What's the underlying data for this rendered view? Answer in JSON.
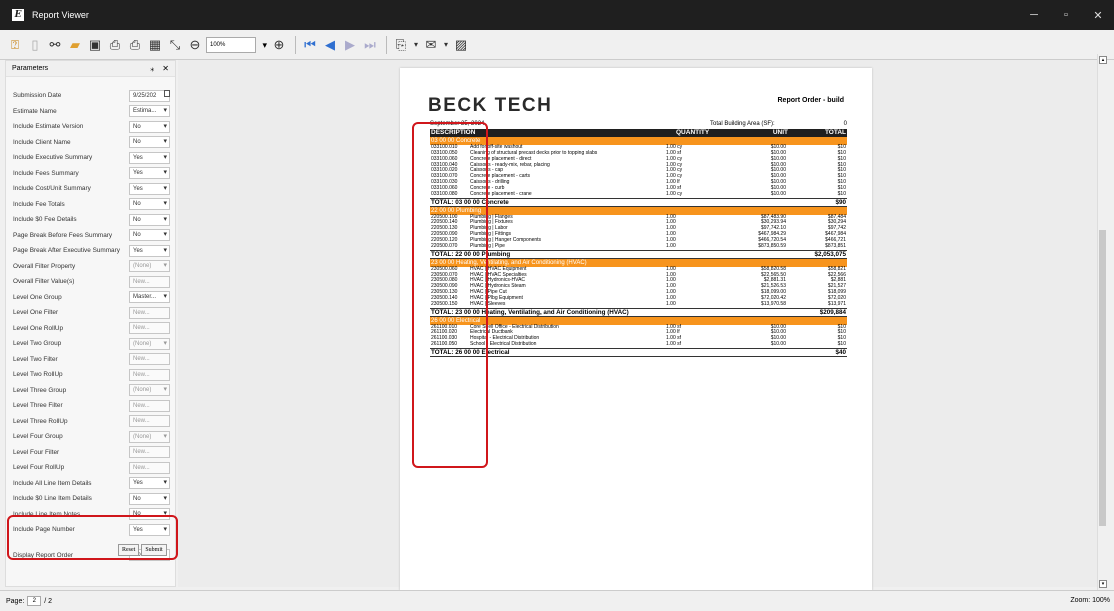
{
  "window": {
    "title": "Report Viewer",
    "app_icon": "E",
    "min": "─",
    "max": "▫",
    "close": "✕"
  },
  "toolbar": {
    "zoom": "100%"
  },
  "parameters": {
    "title": "Parameters",
    "pin": "⁎",
    "close": "✕",
    "rows": [
      {
        "label": "Submission Date",
        "value": "9/25/202",
        "kind": "date"
      },
      {
        "label": "Estimate Name",
        "value": "Estima...",
        "kind": "dd"
      },
      {
        "label": "Include Estimate Version",
        "value": "No",
        "kind": "dd"
      },
      {
        "label": "Include Client Name",
        "value": "No",
        "kind": "dd"
      },
      {
        "label": "Include Executive Summary",
        "value": "Yes",
        "kind": "dd"
      },
      {
        "label": "Include Fees Summary",
        "value": "Yes",
        "kind": "dd"
      },
      {
        "label": "Include Cost/Unit Summary",
        "value": "Yes",
        "kind": "dd"
      },
      {
        "label": "Include Fee Totals",
        "value": "No",
        "kind": "dd"
      },
      {
        "label": "Include $0 Fee Details",
        "value": "No",
        "kind": "dd"
      },
      {
        "label": "Page Break Before Fees Summary",
        "value": "No",
        "kind": "dd"
      },
      {
        "label": "Page Break After Executive Summary",
        "value": "Yes",
        "kind": "dd"
      },
      {
        "label": "Overall Filter Property",
        "value": "(None)",
        "kind": "dd-dis"
      },
      {
        "label": "Overall Filter Value(s)",
        "value": "New...",
        "kind": "dis"
      },
      {
        "label": "Level One Group",
        "value": "Master...",
        "kind": "dd"
      },
      {
        "label": "Level One Filter",
        "value": "New...",
        "kind": "dis"
      },
      {
        "label": "Level One RollUp",
        "value": "New...",
        "kind": "dis"
      },
      {
        "label": "Level Two Group",
        "value": "(None)",
        "kind": "dd-dis"
      },
      {
        "label": "Level Two Filter",
        "value": "New...",
        "kind": "dis"
      },
      {
        "label": "Level Two RollUp",
        "value": "New...",
        "kind": "dis"
      },
      {
        "label": "Level Three Group",
        "value": "(None)",
        "kind": "dd-dis"
      },
      {
        "label": "Level Three Filter",
        "value": "New...",
        "kind": "dis"
      },
      {
        "label": "Level Three RollUp",
        "value": "New...",
        "kind": "dis"
      },
      {
        "label": "Level Four Group",
        "value": "(None)",
        "kind": "dd-dis"
      },
      {
        "label": "Level Four Filter",
        "value": "New...",
        "kind": "dis"
      },
      {
        "label": "Level Four RollUp",
        "value": "New...",
        "kind": "dis"
      },
      {
        "label": "Include All Line Item Details",
        "value": "Yes",
        "kind": "dd"
      },
      {
        "label": "Include $0 Line Item Details",
        "value": "No",
        "kind": "dd"
      },
      {
        "label": "Include Line Item Notes",
        "value": "No",
        "kind": "dd"
      },
      {
        "label": "Include Page Number",
        "value": "Yes",
        "kind": "dd"
      },
      {
        "label": "",
        "value": "",
        "kind": "spacer"
      },
      {
        "label": "Display Report Order",
        "value": "No",
        "kind": "dd"
      }
    ],
    "reset": "Reset",
    "submit": "Submit"
  },
  "report": {
    "logo_a": "BECK TECH",
    "title": "Report Order - build",
    "date": "September 25, 2024",
    "area_label": "Total Building Area (SF):",
    "area_value": "0",
    "headers": {
      "desc": "DESCRIPTION",
      "qty": "QUANTITY",
      "unit": "UNIT",
      "total": "TOTAL"
    },
    "rows": [
      {
        "t": "sec",
        "desc": "03 00 00 Concrete"
      },
      {
        "t": "item",
        "code": "033100.010",
        "desc": "Add for off-site washout",
        "qty": "1.00 cy",
        "unit": "$10.00",
        "total": "$10"
      },
      {
        "t": "item",
        "code": "033100.050",
        "desc": "Cleaning of structural precast decks prior to topping slabs",
        "qty": "1.00 sf",
        "unit": "$10.00",
        "total": "$10"
      },
      {
        "t": "item",
        "code": "033100.060",
        "desc": "Concrete placement - direct",
        "qty": "1.00 cy",
        "unit": "$10.00",
        "total": "$10"
      },
      {
        "t": "item",
        "code": "033100.040",
        "desc": "Caissons - ready-mix, rebar, placing",
        "qty": "1.00 cy",
        "unit": "$10.00",
        "total": "$10"
      },
      {
        "t": "item",
        "code": "033100.020",
        "desc": "Caissons - cap",
        "qty": "1.00 cy",
        "unit": "$10.00",
        "total": "$10"
      },
      {
        "t": "item",
        "code": "033100.070",
        "desc": "Concrete placement - carts",
        "qty": "1.00 cy",
        "unit": "$10.00",
        "total": "$10"
      },
      {
        "t": "item",
        "code": "033100.030",
        "desc": "Caissons - drilling",
        "qty": "1.00 lf",
        "unit": "$10.00",
        "total": "$10"
      },
      {
        "t": "item",
        "code": "033100.060",
        "desc": "Concrete - curb",
        "qty": "1.00 sf",
        "unit": "$10.00",
        "total": "$10"
      },
      {
        "t": "item",
        "code": "033100.080",
        "desc": "Concrete placement - crane",
        "qty": "1.00 cy",
        "unit": "$10.00",
        "total": "$10"
      },
      {
        "t": "tot",
        "desc": "TOTAL: 03 00 00 Concrete",
        "total": "$90"
      },
      {
        "t": "sec",
        "desc": "22 00 00 Plumbing"
      },
      {
        "t": "item",
        "code": "220500.100",
        "desc": "Plumbing | Flanges",
        "qty": "1.00",
        "unit": "$87,483.90",
        "total": "$87,484"
      },
      {
        "t": "item",
        "code": "220500.140",
        "desc": "Plumbing | Fixtures",
        "qty": "1.00",
        "unit": "$30,293.94",
        "total": "$30,294"
      },
      {
        "t": "item",
        "code": "220500.130",
        "desc": "Plumbing | Labor",
        "qty": "1.00",
        "unit": "$97,742.10",
        "total": "$97,742"
      },
      {
        "t": "item",
        "code": "220500.090",
        "desc": "Plumbing | Fittings",
        "qty": "1.00",
        "unit": "$467,984.29",
        "total": "$467,984"
      },
      {
        "t": "item",
        "code": "220500.120",
        "desc": "Plumbing | Hanger Components",
        "qty": "1.00",
        "unit": "$466,720.54",
        "total": "$466,721"
      },
      {
        "t": "item",
        "code": "220500.070",
        "desc": "Plumbing | Pipe",
        "qty": "1.00",
        "unit": "$873,850.59",
        "total": "$873,851"
      },
      {
        "t": "tot",
        "desc": "TOTAL: 22 00 00 Plumbing",
        "total": "$2,053,075"
      },
      {
        "t": "sec",
        "desc": "23 00 00 Heating, Ventilating, and Air Conditioning (HVAC)"
      },
      {
        "t": "item",
        "code": "230500.060",
        "desc": "HVAC | HVAC Equipment",
        "qty": "1.00",
        "unit": "$58,820.58",
        "total": "$58,821"
      },
      {
        "t": "item",
        "code": "230500.070",
        "desc": "HVAC | HVAC Specialties",
        "qty": "1.00",
        "unit": "$22,565.50",
        "total": "$22,566"
      },
      {
        "t": "item",
        "code": "230500.080",
        "desc": "HVAC | Hydronics-HVAC",
        "qty": "1.00",
        "unit": "$2,881.31",
        "total": "$2,881"
      },
      {
        "t": "item",
        "code": "230500.090",
        "desc": "HVAC | Hydronics Steam",
        "qty": "1.00",
        "unit": "$21,526.53",
        "total": "$21,527"
      },
      {
        "t": "item",
        "code": "230500.130",
        "desc": "HVAC | Pipe Cut",
        "qty": "1.00",
        "unit": "$18,099.00",
        "total": "$18,099"
      },
      {
        "t": "item",
        "code": "230500.140",
        "desc": "HVAC | Plbg Equipment",
        "qty": "1.00",
        "unit": "$72,020.42",
        "total": "$72,020"
      },
      {
        "t": "item",
        "code": "230500.150",
        "desc": "HVAC | Sleeves",
        "qty": "1.00",
        "unit": "$13,970.58",
        "total": "$13,971"
      },
      {
        "t": "tot",
        "desc": "TOTAL: 23 00 00 Heating, Ventilating, and Air Conditioning (HVAC)",
        "total": "$209,884"
      },
      {
        "t": "sec",
        "desc": "26 00 00 Electrical"
      },
      {
        "t": "item",
        "code": "261100.010",
        "desc": "Core Shell Office - Electrical Distribution",
        "qty": "1.00 sf",
        "unit": "$10.00",
        "total": "$10"
      },
      {
        "t": "item",
        "code": "261100.020",
        "desc": "Electrical Ductbank",
        "qty": "1.00 lf",
        "unit": "$10.00",
        "total": "$10"
      },
      {
        "t": "item",
        "code": "261100.030",
        "desc": "Hospital - Electrical Distribution",
        "qty": "1.00 sf",
        "unit": "$10.00",
        "total": "$10"
      },
      {
        "t": "item",
        "code": "261100.050",
        "desc": "School - Electrical Distribution",
        "qty": "1.00 sf",
        "unit": "$10.00",
        "total": "$10"
      },
      {
        "t": "tot",
        "desc": "TOTAL: 26 00 00 Electrical",
        "total": "$40"
      }
    ]
  },
  "status": {
    "page_label": "Page:",
    "page_current": "2",
    "page_total": "/ 2",
    "zoom": "Zoom: 100%"
  },
  "colors": {
    "accent": "#f7941d",
    "header": "#1f1f1f",
    "highlight": "#d0161b"
  }
}
